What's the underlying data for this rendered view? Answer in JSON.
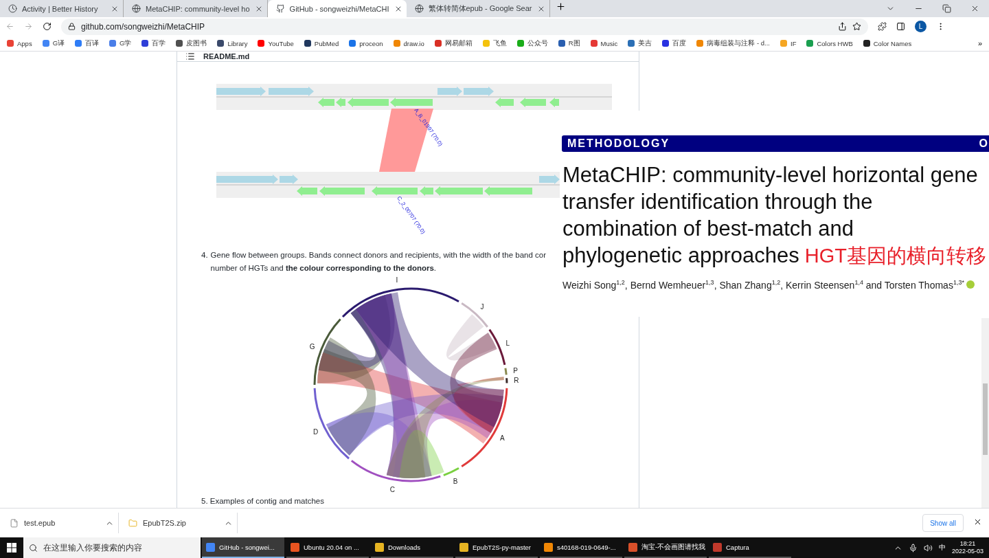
{
  "browser": {
    "tabs": [
      {
        "title": "Activity | Better History",
        "selected": false
      },
      {
        "title": "MetaCHIP: community-level ho",
        "selected": false
      },
      {
        "title": "GitHub - songweizhi/MetaCHI",
        "selected": true
      },
      {
        "title": "繁体转简体epub - Google Sear",
        "selected": false
      }
    ],
    "url": "github.com/songweizhi/MetaCHIP",
    "profile": "L",
    "bookmarks": [
      {
        "label": "Apps",
        "color": "#e94235"
      },
      {
        "label": "G译",
        "color": "#4285f4"
      },
      {
        "label": "百译",
        "color": "#2f7df6"
      },
      {
        "label": "G学",
        "color": "#4a7ee8"
      },
      {
        "label": "百学",
        "color": "#2f3fd8"
      },
      {
        "label": "皮图书",
        "color": "#505050"
      },
      {
        "label": "Library",
        "color": "#3b4a6b"
      },
      {
        "label": "YouTube",
        "color": "#ff0000"
      },
      {
        "label": "PubMed",
        "color": "#20385e"
      },
      {
        "label": "proceon",
        "color": "#1a73e8"
      },
      {
        "label": "draw.io",
        "color": "#f08705"
      },
      {
        "label": "网易邮箱",
        "color": "#d93025"
      },
      {
        "label": "飞鱼",
        "color": "#f4c20d"
      },
      {
        "label": "公众号",
        "color": "#1aad19"
      },
      {
        "label": "R图",
        "color": "#2a5fb0"
      },
      {
        "label": "Music",
        "color": "#e53935"
      },
      {
        "label": "美吉",
        "color": "#2b6fb5"
      },
      {
        "label": "百度",
        "color": "#2932e1"
      },
      {
        "label": "病毒组装与注释 - d...",
        "color": "#f08705"
      },
      {
        "label": "IF",
        "color": "#f5a623"
      },
      {
        "label": "Colors HWB",
        "color": "#1a9f50"
      },
      {
        "label": "Color Names",
        "color": "#222222"
      }
    ],
    "more_bookmarks": "»"
  },
  "readme": {
    "filename": "README.md",
    "gene_labels": [
      "A_B_01997 (70.0)",
      "C_2_00707 (70.0)"
    ],
    "item": {
      "number": "4.",
      "line_1": "Gene flow between groups. Bands connect donors and recipients, with the width of the band cor",
      "line_2": "number of HGTs and **the colour corresponding to the donors**."
    },
    "chord": {
      "groups": [
        {
          "label": "I",
          "color": "#2a1a6e"
        },
        {
          "label": "J",
          "color": "#c9b9c3"
        },
        {
          "label": "L",
          "color": "#6b1a3a"
        },
        {
          "label": "P",
          "color": "#8a8a50"
        },
        {
          "label": "R",
          "color": "#3a2a2a"
        },
        {
          "label": "A",
          "color": "#e03a3a"
        },
        {
          "label": "B",
          "color": "#7ad040"
        },
        {
          "label": "C",
          "color": "#a050c0"
        },
        {
          "label": "D",
          "color": "#7060d0"
        },
        {
          "label": "G",
          "color": "#4a5a3a"
        }
      ]
    },
    "next_item": "5. Examples of contig and matches"
  },
  "article": {
    "section": "METHODOLOGY",
    "section_right": "O",
    "title_lines": [
      "MetaCHIP: community-level horizontal gene",
      "transfer identification through the",
      "combination of best-match and",
      "phylogenetic approaches"
    ],
    "annotation": "HGT基因的横向转移",
    "authors": "Weizhi Song$^{1,2}$, Bernd Wemheuer$^{1,3}$, Shan Zhang$^{1,2}$, Kerrin Steensen$^{1,4}$ and Torsten Thomas$^{1,3*}$"
  },
  "downloads": {
    "files": [
      "test.epub",
      "EpubT2S.zip"
    ],
    "show_all": "Show all"
  },
  "taskbar": {
    "search_placeholder": "在这里输入你要搜索的内容",
    "apps": [
      {
        "title": "GitHub - songwei...",
        "selected": true
      },
      {
        "title": "Ubuntu 20.04 on ...",
        "selected": false
      },
      {
        "title": "Downloads",
        "selected": false
      },
      {
        "title": "EpubT2S-py-master",
        "selected": false
      },
      {
        "title": "s40168-019-0649-...",
        "selected": false
      },
      {
        "title": "淘宝-不会画图请找我",
        "selected": false
      },
      {
        "title": "Captura",
        "selected": false
      }
    ],
    "ime": "中",
    "time": "18:21",
    "date": "2022-05-03"
  }
}
